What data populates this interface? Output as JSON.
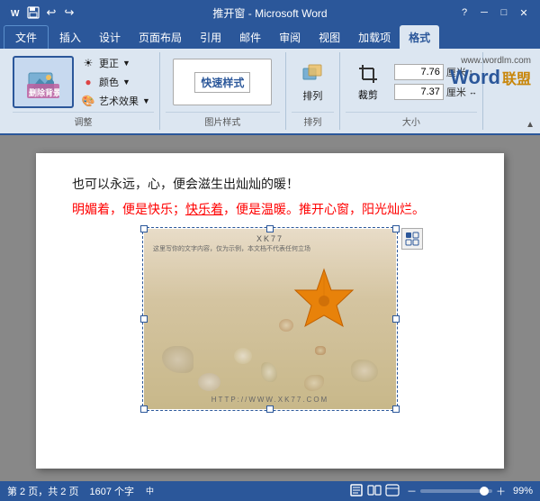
{
  "titleBar": {
    "title": "推开窗 - Microsoft Word",
    "helpBtn": "?",
    "minBtn": "─",
    "maxBtn": "□",
    "closeBtn": "✕"
  },
  "quickAccess": {
    "save": "💾",
    "undo": "↩",
    "redo": "↪"
  },
  "ribbonTabs": [
    {
      "label": "文件",
      "id": "file"
    },
    {
      "label": "插入",
      "id": "insert"
    },
    {
      "label": "设计",
      "id": "design"
    },
    {
      "label": "页面布局",
      "id": "layout"
    },
    {
      "label": "引用",
      "id": "references"
    },
    {
      "label": "邮件",
      "id": "mail"
    },
    {
      "label": "审阅",
      "id": "review"
    },
    {
      "label": "视图",
      "id": "view"
    },
    {
      "label": "加载项",
      "id": "addins"
    },
    {
      "label": "格式",
      "id": "format",
      "active": true
    }
  ],
  "ribbonGroups": {
    "adjust": {
      "label": "调整",
      "removeBg": "删除背景",
      "corrections": "更正",
      "color": "颜色",
      "artisticEffects": "艺术效果"
    },
    "pictureStyles": {
      "label": "图片样式",
      "quickStyles": "快速样式"
    },
    "arrange": {
      "label": "排列",
      "btn": "排列"
    },
    "size": {
      "label": "大小",
      "crop": "裁剪",
      "height": "7.76",
      "width": "7.37",
      "unit": "厘米"
    }
  },
  "wordLogo": {
    "text": "Word",
    "suffix": "联盟",
    "url": "www.wordlm.com"
  },
  "document": {
    "text1": "也可以永远，心，便会滋生出灿灿的暖！",
    "text2": "明媚着，便是快乐；快乐着，便是温暖。推开心窗，阳光灿烂。",
    "underlineWords": "快乐着",
    "watermarkTop": "XK77",
    "watermarkTopSub": "这里写你的文字内容，仅为示例，本文档不代表任何立场",
    "watermarkBottom": "HTTP://WWW.XK77.COM"
  },
  "statusBar": {
    "page": "第 2 页，共 2 页",
    "wordCount": "1607 个字",
    "language": "中文",
    "zoomPercent": "99%"
  }
}
